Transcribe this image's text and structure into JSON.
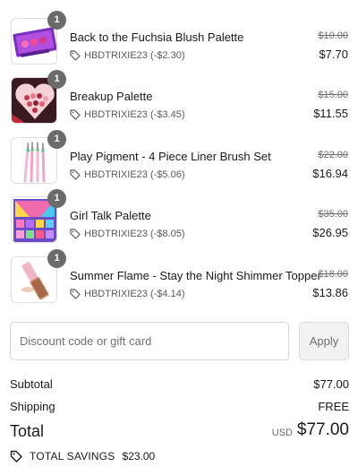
{
  "items": [
    {
      "name": "Back to the Fuchsia Blush Palette",
      "discount": "HBDTRIXIE23 (-$2.30)",
      "original_price": "$10.00",
      "price": "$7.70",
      "quantity": "1",
      "thumb": "blush-palette"
    },
    {
      "name": "Breakup Palette",
      "discount": "HBDTRIXIE23 (-$3.45)",
      "original_price": "$15.00",
      "price": "$11.55",
      "quantity": "1",
      "thumb": "heart-palette"
    },
    {
      "name": "Play Pigment - 4 Piece Liner Brush Set",
      "discount": "HBDTRIXIE23 (-$5.06)",
      "original_price": "$22.00",
      "price": "$16.94",
      "quantity": "1",
      "thumb": "brush-set"
    },
    {
      "name": "Girl Talk Palette",
      "discount": "HBDTRIXIE23 (-$8.05)",
      "original_price": "$35.00",
      "price": "$26.95",
      "quantity": "1",
      "thumb": "eyeshadow-palette"
    },
    {
      "name": "Summer Flame - Stay the Night Shimmer Topper",
      "discount": "HBDTRIXIE23 (-$4.14)",
      "original_price": "$18.00",
      "price": "$13.86",
      "quantity": "1",
      "thumb": "shimmer-tube"
    }
  ],
  "discount_field": {
    "placeholder": "Discount code or gift card",
    "value": "",
    "apply_label": "Apply"
  },
  "summary": {
    "subtotal_label": "Subtotal",
    "subtotal_value": "$77.00",
    "shipping_label": "Shipping",
    "shipping_value": "FREE",
    "total_label": "Total",
    "currency": "USD",
    "total_value": "$77.00"
  },
  "savings": {
    "label": "TOTAL SAVINGS",
    "value": "$23.00"
  },
  "colors": {
    "badge": "#6b6b6b",
    "text": "#1a1a1a",
    "muted": "#707070",
    "border": "#d6d6d6"
  }
}
